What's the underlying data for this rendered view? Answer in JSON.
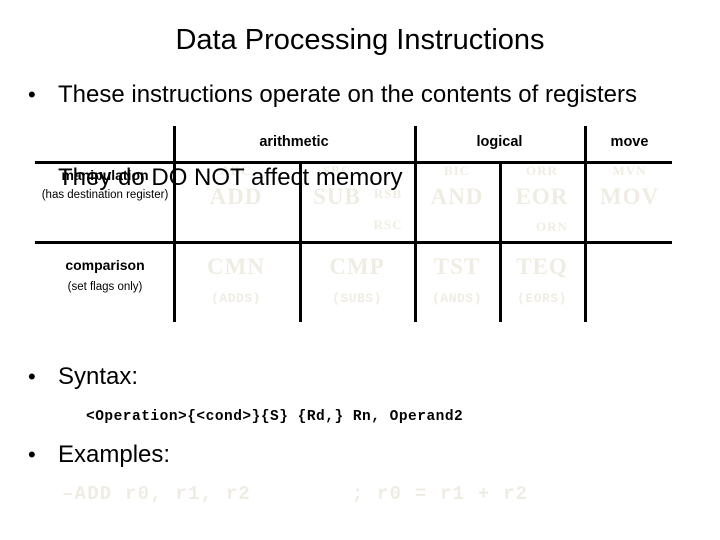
{
  "slide": {
    "title": "Data Processing Instructions",
    "bullets": {
      "intro": "These instructions operate on the contents of registers",
      "syntax": "Syntax:",
      "examples": "Examples:"
    },
    "overlay_note": "They do DO NOT affect memory",
    "syntax_code": "<Operation>{<cond>}{S} {Rd,} Rn, Operand2",
    "example_code": "–ADD r0, r1, r2        ; r0 = r1 + r2",
    "bullet_glyph": "•"
  },
  "table": {
    "headers": [
      {
        "label": "",
        "name": "corner"
      },
      {
        "label": "arithmetic",
        "name": "arithmetic"
      },
      {
        "label": "logical",
        "name": "logical"
      },
      {
        "label": "move",
        "name": "move"
      }
    ],
    "rows": [
      {
        "label": "manipulation",
        "sublabel": "(has destination register)",
        "cells": {
          "add": {
            "small_top": "ADC",
            "big": "ADD",
            "small_bottom": ""
          },
          "sub": {
            "small_top": "SBC",
            "big": "SUB",
            "small_right_1": "RSB",
            "small_right_2": "RSC"
          },
          "and": {
            "small_top": "BIC",
            "big": "AND"
          },
          "eor": {
            "small_top": "ORR",
            "big": "EOR",
            "small_bottom": "ORN"
          },
          "mov": {
            "small_top": "MVN",
            "big": "MOV"
          }
        }
      },
      {
        "label": "comparison",
        "sublabel": "(set flags only)",
        "cells": {
          "cmn": {
            "big": "CMN",
            "paren": "(ADDS)"
          },
          "cmp": {
            "big": "CMP",
            "paren": "(SUBS)"
          },
          "tst": {
            "big": "TST",
            "paren": "(ANDS)"
          },
          "teq": {
            "big": "TEQ",
            "paren": "(EORS)"
          }
        }
      }
    ]
  },
  "colors": {
    "text": "#000000",
    "faded": "#efede3",
    "background": "#ffffff",
    "rule": "#000000"
  }
}
